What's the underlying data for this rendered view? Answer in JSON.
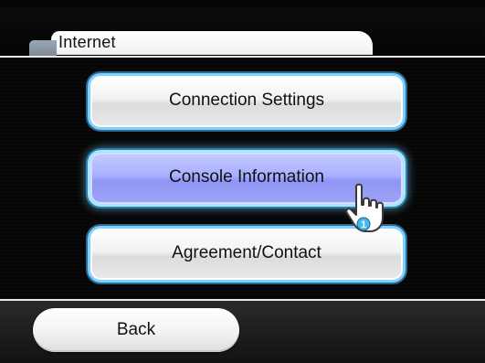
{
  "header": {
    "title": "Internet",
    "icon": "folder-tab-icon"
  },
  "menu": {
    "items": [
      {
        "label": "Connection Settings",
        "selected": false
      },
      {
        "label": "Console Information",
        "selected": true
      },
      {
        "label": "Agreement/Contact",
        "selected": false
      }
    ]
  },
  "footer": {
    "back_label": "Back"
  },
  "pointer": {
    "icon": "hand-pointer-icon",
    "player_number": "1"
  },
  "colors": {
    "button_border": "#7fd0ff",
    "selected_fill": "#a9afff",
    "header_tab": "#ffffff",
    "background": "#050505"
  }
}
